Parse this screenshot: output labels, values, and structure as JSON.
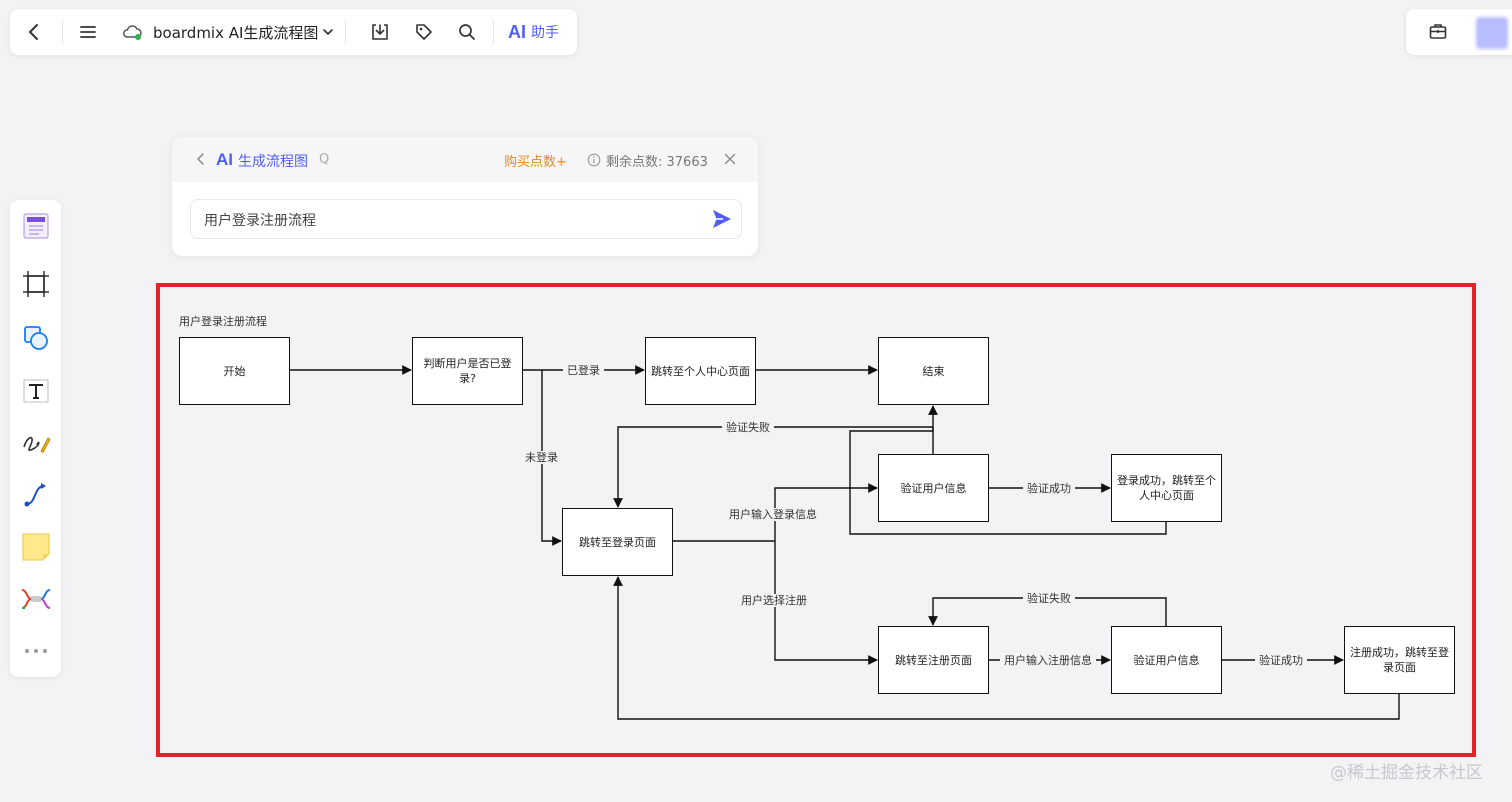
{
  "toolbar": {
    "title": "boardmix AI生成流程图",
    "ai_logo": "AI",
    "ai_label": "助手"
  },
  "ai_panel": {
    "logo": "AI",
    "title": "生成流程图",
    "shortcut": "Q",
    "buy_label": "购买点数",
    "buy_plus": "+",
    "remaining_label": "剩余点数: 37663",
    "prompt_value": "用户登录注册流程"
  },
  "diagram": {
    "title": "用户登录注册流程",
    "nodes": {
      "start": "开始",
      "check_login": "判断用户是否已登录?",
      "to_profile": "跳转至个人中心页面",
      "end": "结束",
      "verify_user_login": "验证用户信息",
      "login_success": "登录成功，跳转至个人中心页面",
      "to_login": "跳转至登录页面",
      "to_register": "跳转至注册页面",
      "verify_user_register": "验证用户信息",
      "register_success": "注册成功，跳转至登录页面"
    },
    "edges": {
      "logged_in": "已登录",
      "not_logged_in": "未登录",
      "verify_fail_1": "验证失败",
      "verify_success_1": "验证成功",
      "input_login": "用户输入登录信息",
      "choose_register": "用户选择注册",
      "verify_fail_2": "验证失败",
      "input_register": "用户输入注册信息",
      "verify_success_2": "验证成功"
    }
  },
  "watermark": "@稀土掘金技术社区",
  "colors": {
    "accent": "#4f5dff",
    "highlight": "#e3232c",
    "buy": "#e08a1e",
    "canvas": "#f3f3f5"
  },
  "icons": {
    "back": "chevron-left-icon",
    "menu": "hamburger-icon",
    "cloud": "cloud-sync-icon",
    "dropdown": "chevron-down-icon",
    "download": "download-icon",
    "tag": "tag-icon",
    "search": "search-icon",
    "toolbox": "toolbox-icon",
    "send": "send-icon",
    "close": "close-icon",
    "info": "info-icon"
  }
}
